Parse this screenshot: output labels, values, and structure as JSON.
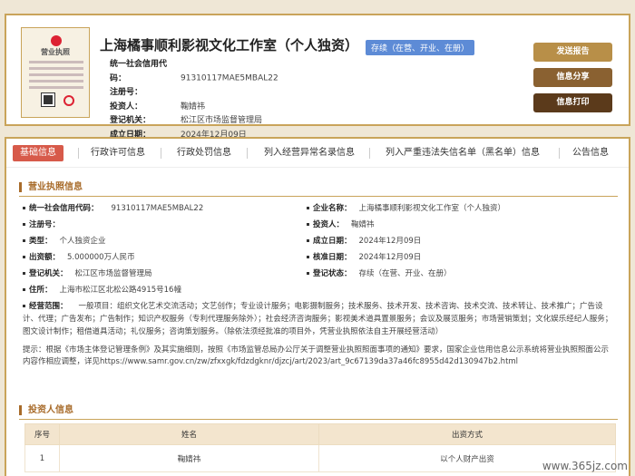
{
  "header": {
    "license_title": "营业执照",
    "company_name": "上海橘事顺利影视文化工作室（个人独资）",
    "status": "存续（在营、开业、在册）",
    "info": [
      {
        "label": "统一社会信用代码：",
        "value": "91310117MAE5MBAL22"
      },
      {
        "label": "注册号：",
        "value": ""
      },
      {
        "label": "投资人：",
        "value": "鞠婧祎"
      },
      {
        "label": "登记机关：",
        "value": "松江区市场监督管理局"
      },
      {
        "label": "成立日期：",
        "value": "2024年12月09日"
      }
    ],
    "buttons": {
      "report": "发送报告",
      "share": "信息分享",
      "print": "信息打印"
    }
  },
  "tabs": [
    "基础信息",
    "行政许可信息",
    "行政处罚信息",
    "列入经营异常名录信息",
    "列入严重违法失信名单（黑名单）信息",
    "公告信息"
  ],
  "license_section": {
    "title": "营业执照信息",
    "left": [
      {
        "label": "统一社会信用代码：",
        "value": "91310117MAE5MBAL22"
      },
      {
        "label": "注册号：",
        "value": ""
      },
      {
        "label": "类型：",
        "value": "个人独资企业"
      },
      {
        "label": "出资额：",
        "value": "5.000000万人民币"
      },
      {
        "label": "登记机关：",
        "value": "松江区市场监督管理局"
      },
      {
        "label": "住所：",
        "value": "上海市松江区北松公路4915号16幢"
      }
    ],
    "right": [
      {
        "label": "企业名称：",
        "value": "上海橘事顺利影视文化工作室（个人独资）"
      },
      {
        "label": "投资人：",
        "value": "鞠婧祎"
      },
      {
        "label": "成立日期：",
        "value": "2024年12月09日"
      },
      {
        "label": "核准日期：",
        "value": "2024年12月09日"
      },
      {
        "label": "登记状态：",
        "value": "存续（在营、开业、在册）"
      }
    ],
    "scope_label": "经营范围：",
    "scope_value": "一般项目：组织文化艺术交流活动；文艺创作；专业设计服务；电影摄制服务；技术服务、技术开发、技术咨询、技术交流、技术转让、技术推广；广告设计、代理；广告发布；广告制作；知识产权服务（专利代理服务除外）；社会经济咨询服务；影视美术道具置景服务；会议及展览服务；市场营销策划；文化娱乐经纪人服务；图文设计制作；租借道具活动；礼仪服务；咨询策划服务。（除依法须经批准的项目外，凭营业执照依法自主开展经营活动）",
    "hint": "提示：根据《市场主体登记管理条例》及其实施细则，按照《市场监管总局办公厅关于调整营业执照照面事项的通知》要求，国家企业信用信息公示系统将营业执照照面公示内容作相应调整，详见https://www.samr.gov.cn/zw/zfxxgk/fdzdgknr/djzcj/art/2023/art_9c67139da37a46fc8955d42d130947b2.html"
  },
  "investor_section": {
    "title": "投资人信息",
    "columns": [
      "序号",
      "姓名",
      "出资方式"
    ],
    "rows": [
      [
        "1",
        "鞠婧祎",
        "以个人财产出资"
      ]
    ]
  },
  "watermark": "www.365jz.com"
}
